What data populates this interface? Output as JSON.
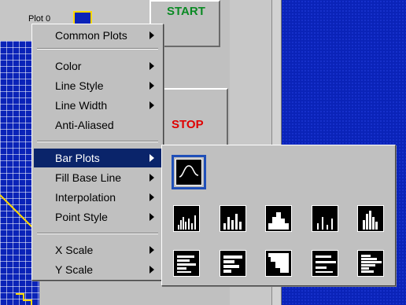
{
  "legend": {
    "plot_name": "Plot 0"
  },
  "buttons": {
    "start_label": "START",
    "stop_label": "STOP"
  },
  "context_menu": {
    "items": [
      {
        "label": "Common Plots",
        "submenu": true
      },
      {
        "label": "Color",
        "submenu": true
      },
      {
        "label": "Line Style",
        "submenu": true
      },
      {
        "label": "Line Width",
        "submenu": true
      },
      {
        "label": "Anti-Aliased",
        "submenu": false
      },
      {
        "label": "Bar Plots",
        "submenu": true,
        "selected": true
      },
      {
        "label": "Fill Base Line",
        "submenu": true
      },
      {
        "label": "Interpolation",
        "submenu": true
      },
      {
        "label": "Point Style",
        "submenu": true
      },
      {
        "label": "X Scale",
        "submenu": true
      },
      {
        "label": "Y Scale",
        "submenu": true
      }
    ]
  },
  "bar_plots_submenu": {
    "options": [
      "line-plot-icon",
      "vertical-bar-plot-icon",
      "horizontal-bar-plot-icon"
    ]
  },
  "colors": {
    "plot_background": "#0a23b8",
    "menu_highlight": "#0a246a",
    "start_text": "#0a8a24",
    "stop_text": "#e00000",
    "selected_tile_border": "#1f4fb8",
    "plot_trace": "#ffd800"
  }
}
